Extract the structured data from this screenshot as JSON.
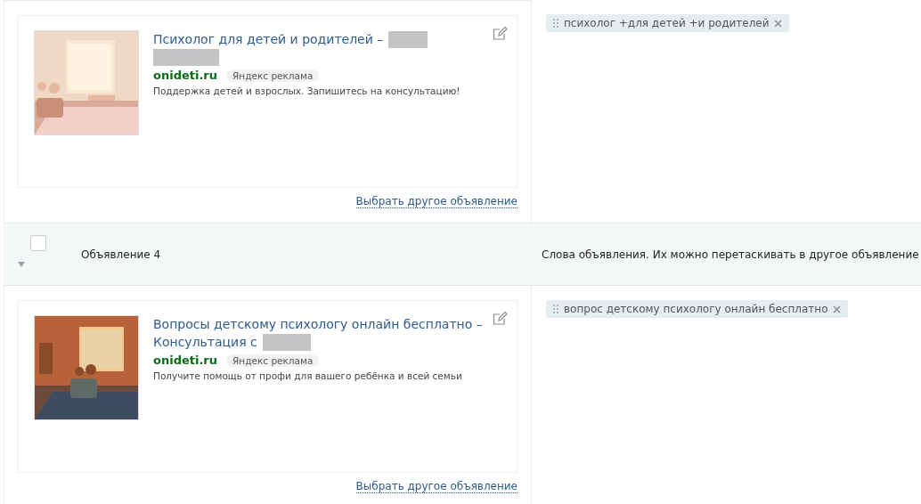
{
  "groups": [
    {
      "ad": {
        "title": [
          [
            {
              "kind": "text",
              "text": "Психолог для детей и родителей –"
            },
            {
              "kind": "redacted_short"
            }
          ],
          [
            {
              "kind": "redacted_long"
            }
          ]
        ],
        "domain": "onideti.ru",
        "badge": "Яндекс реклама",
        "text": "Поддержка детей и взрослых. Запишитесь на консультацию!"
      },
      "link": "Выбрать другое объявление",
      "phrases": [
        "психолог +для детей +и родителей"
      ]
    },
    {
      "header": {
        "checked": false,
        "expanded": true,
        "name": "Объявление 4",
        "hint": "Слова объявления. Их можно перетаскивать в другое объявление"
      },
      "ad": {
        "title": [
          [
            {
              "kind": "text",
              "text": "Вопросы детскому психологу онлайн бесплатно –"
            }
          ],
          [
            {
              "kind": "text",
              "text": "Консультация с"
            },
            {
              "kind": "redacted_mid"
            }
          ]
        ],
        "domain": "onideti.ru",
        "badge": "Яндекс реклама",
        "text": "Получите помощь от профи для вашего ребёнка и всей семьи"
      },
      "link": "Выбрать другое объявление",
      "phrases": [
        "вопрос детскому психологу онлайн бесплатно"
      ]
    }
  ]
}
